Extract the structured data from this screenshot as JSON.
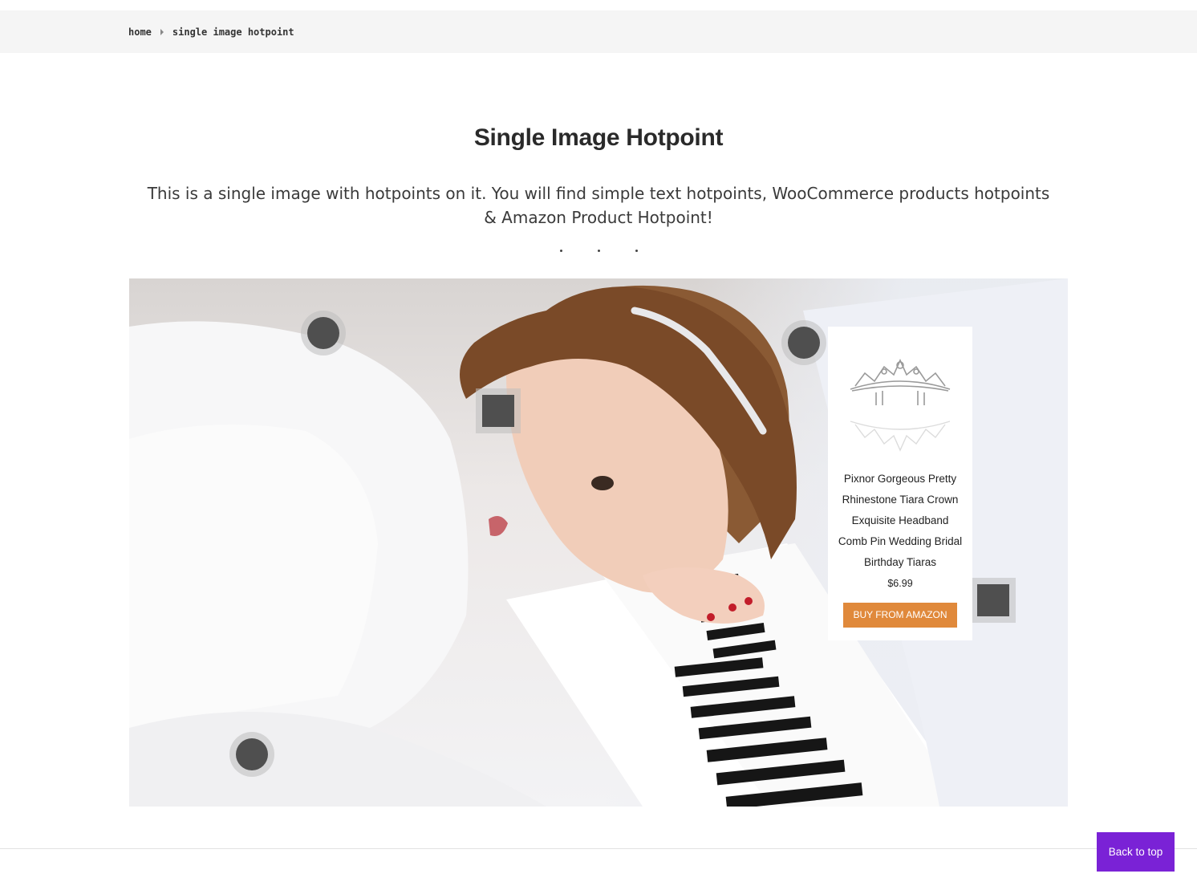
{
  "breadcrumb": {
    "home": "home",
    "current": "single image hotpoint"
  },
  "page": {
    "title": "Single Image Hotpoint",
    "description": "This is a single image with hotpoints on it. You will find simple text hotpoints, WooCommerce products hotpoints & Amazon Product Hotpoint!"
  },
  "hotpoints": {
    "count": 5,
    "shapes": [
      "circle",
      "square",
      "circle",
      "square",
      "circle"
    ]
  },
  "product": {
    "name": "Pixnor Gorgeous Pretty Rhinestone Tiara Crown Exquisite Headband Comb Pin Wedding Bridal Birthday Tiaras",
    "price": "$6.99",
    "button_label": "BUY FROM AMAZON",
    "button_color": "#e0893b"
  },
  "footer": {
    "back_to_top": "Back to top",
    "back_to_top_color": "#7a22d6"
  }
}
